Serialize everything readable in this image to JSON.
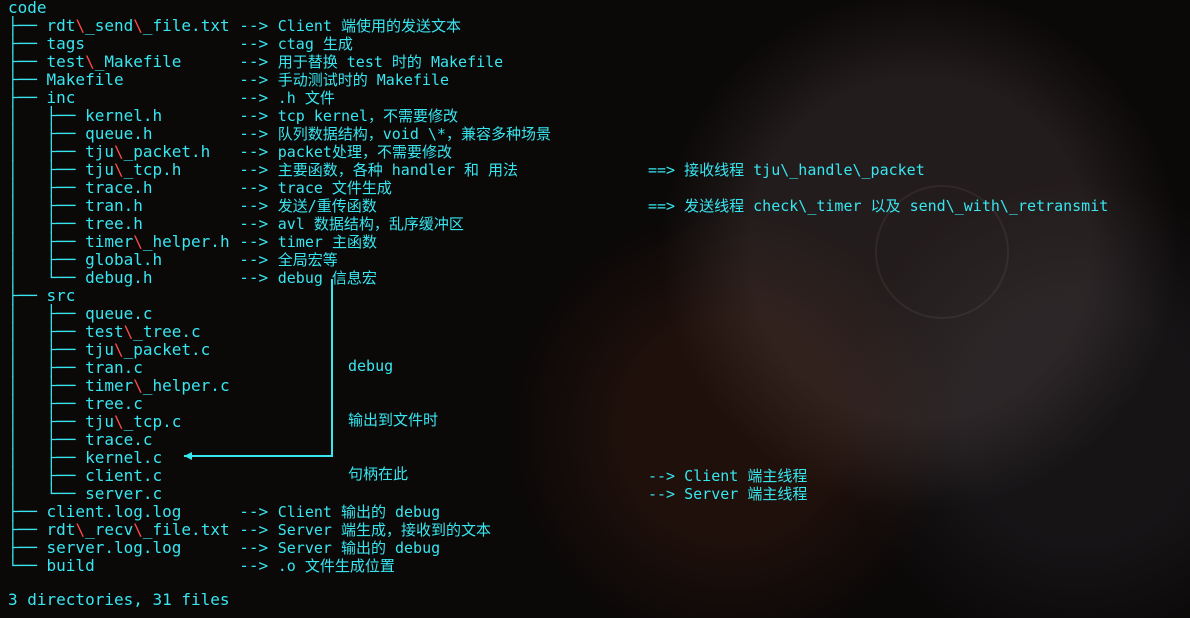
{
  "terminal": {
    "root": "code",
    "summary": "3 directories, 31 files",
    "lines": [
      {
        "prefix": "├── ",
        "parts": [
          [
            "rdt",
            "n"
          ],
          [
            "\\",
            "r"
          ],
          [
            "_send",
            "n"
          ],
          [
            "\\",
            "r"
          ],
          [
            "_file.txt",
            "n"
          ]
        ],
        "arrow": "-->",
        "desc": "Client 端使用的发送文本",
        "desc2": ""
      },
      {
        "prefix": "├── ",
        "parts": [
          [
            "tags",
            "n"
          ]
        ],
        "arrow": "-->",
        "desc": "ctag 生成",
        "desc2": ""
      },
      {
        "prefix": "├── ",
        "parts": [
          [
            "test",
            "n"
          ],
          [
            "\\",
            "r"
          ],
          [
            "_Makefile",
            "n"
          ]
        ],
        "arrow": "-->",
        "desc": "用于替换 test 时的 Makefile",
        "desc2": ""
      },
      {
        "prefix": "├── ",
        "parts": [
          [
            "Makefile",
            "n"
          ]
        ],
        "arrow": "-->",
        "desc": "手动测试时的 Makefile",
        "desc2": ""
      },
      {
        "prefix": "├── ",
        "parts": [
          [
            "inc",
            "n"
          ]
        ],
        "arrow": "-->",
        "desc": ".h 文件",
        "desc2": ""
      },
      {
        "prefix": "│   ├── ",
        "parts": [
          [
            "kernel.h",
            "n"
          ]
        ],
        "arrow": "-->",
        "desc": "tcp kernel，不需要修改",
        "desc2": ""
      },
      {
        "prefix": "│   ├── ",
        "parts": [
          [
            "queue.h",
            "n"
          ]
        ],
        "arrow": "-->",
        "desc": "队列数据结构，void \\*，兼容多种场景",
        "desc2": ""
      },
      {
        "prefix": "│   ├── ",
        "parts": [
          [
            "tju",
            "n"
          ],
          [
            "\\",
            "r"
          ],
          [
            "_packet.h",
            "n"
          ]
        ],
        "arrow": "-->",
        "desc": "packet处理，不需要修改",
        "desc2": ""
      },
      {
        "prefix": "│   ├── ",
        "parts": [
          [
            "tju",
            "n"
          ],
          [
            "\\",
            "r"
          ],
          [
            "_tcp.h",
            "n"
          ]
        ],
        "arrow": "-->",
        "desc": "主要函数，各种 handler 和 用法",
        "desc2": "==> 接收线程 tju\\_handle\\_packet"
      },
      {
        "prefix": "│   ├── ",
        "parts": [
          [
            "trace.h",
            "n"
          ]
        ],
        "arrow": "-->",
        "desc": "trace 文件生成",
        "desc2": ""
      },
      {
        "prefix": "│   ├── ",
        "parts": [
          [
            "tran.h",
            "n"
          ]
        ],
        "arrow": "-->",
        "desc": "发送/重传函数",
        "desc2": "==> 发送线程 check\\_timer 以及 send\\_with\\_retransmit"
      },
      {
        "prefix": "│   ├── ",
        "parts": [
          [
            "tree.h",
            "n"
          ]
        ],
        "arrow": "-->",
        "desc": "avl 数据结构，乱序缓冲区",
        "desc2": ""
      },
      {
        "prefix": "│   ├── ",
        "parts": [
          [
            "timer",
            "n"
          ],
          [
            "\\",
            "r"
          ],
          [
            "_helper.h",
            "n"
          ]
        ],
        "arrow": "-->",
        "desc": "timer 主函数",
        "desc2": ""
      },
      {
        "prefix": "│   ├── ",
        "parts": [
          [
            "global.h",
            "n"
          ]
        ],
        "arrow": "-->",
        "desc": "全局宏等",
        "desc2": ""
      },
      {
        "prefix": "│   └── ",
        "parts": [
          [
            "debug.h",
            "n"
          ]
        ],
        "arrow": "-->",
        "desc": "debug 信息宏",
        "desc2": ""
      },
      {
        "prefix": "├── ",
        "parts": [
          [
            "src",
            "n"
          ]
        ],
        "arrow": "",
        "desc": "",
        "desc2": ""
      },
      {
        "prefix": "│   ├── ",
        "parts": [
          [
            "queue.c",
            "n"
          ]
        ],
        "arrow": "",
        "desc": "",
        "desc2": ""
      },
      {
        "prefix": "│   ├── ",
        "parts": [
          [
            "test",
            "n"
          ],
          [
            "\\",
            "r"
          ],
          [
            "_tree.c",
            "n"
          ]
        ],
        "arrow": "",
        "desc": "",
        "desc2": ""
      },
      {
        "prefix": "│   ├── ",
        "parts": [
          [
            "tju",
            "n"
          ],
          [
            "\\",
            "r"
          ],
          [
            "_packet.c",
            "n"
          ]
        ],
        "arrow": "",
        "desc": "",
        "desc2": ""
      },
      {
        "prefix": "│   ├── ",
        "parts": [
          [
            "tran.c",
            "n"
          ]
        ],
        "arrow": "",
        "desc": "",
        "desc2": ""
      },
      {
        "prefix": "│   ├── ",
        "parts": [
          [
            "timer",
            "n"
          ],
          [
            "\\",
            "r"
          ],
          [
            "_helper.c",
            "n"
          ]
        ],
        "arrow": "",
        "desc": "",
        "desc2": ""
      },
      {
        "prefix": "│   ├── ",
        "parts": [
          [
            "tree.c",
            "n"
          ]
        ],
        "arrow": "",
        "desc": "",
        "desc2": ""
      },
      {
        "prefix": "│   ├── ",
        "parts": [
          [
            "tju",
            "n"
          ],
          [
            "\\",
            "r"
          ],
          [
            "_tcp.c",
            "n"
          ]
        ],
        "arrow": "",
        "desc": "",
        "desc2": ""
      },
      {
        "prefix": "│   ├── ",
        "parts": [
          [
            "trace.c",
            "n"
          ]
        ],
        "arrow": "",
        "desc": "",
        "desc2": ""
      },
      {
        "prefix": "│   ├── ",
        "parts": [
          [
            "kernel.c",
            "n"
          ]
        ],
        "arrow": "",
        "desc": "",
        "desc2": ""
      },
      {
        "prefix": "│   ├── ",
        "parts": [
          [
            "client.c",
            "n"
          ]
        ],
        "arrow": "",
        "desc": "",
        "desc2": "--> Client 端主线程"
      },
      {
        "prefix": "│   └── ",
        "parts": [
          [
            "server.c",
            "n"
          ]
        ],
        "arrow": "",
        "desc": "",
        "desc2": "--> Server 端主线程"
      },
      {
        "prefix": "├── ",
        "parts": [
          [
            "client.log.log",
            "n"
          ]
        ],
        "arrow": "-->",
        "desc": "Client 输出的 debug",
        "desc2": ""
      },
      {
        "prefix": "├── ",
        "parts": [
          [
            "rdt",
            "n"
          ],
          [
            "\\",
            "r"
          ],
          [
            "_recv",
            "n"
          ],
          [
            "\\",
            "r"
          ],
          [
            "_file.txt",
            "n"
          ]
        ],
        "arrow": "-->",
        "desc": "Server 端生成，接收到的文本",
        "desc2": ""
      },
      {
        "prefix": "├── ",
        "parts": [
          [
            "server.log.log",
            "n"
          ]
        ],
        "arrow": "-->",
        "desc": "Server 输出的 debug",
        "desc2": ""
      },
      {
        "prefix": "└── ",
        "parts": [
          [
            "build",
            "n"
          ]
        ],
        "arrow": "-->",
        "desc": ".o 文件生成位置",
        "desc2": ""
      }
    ],
    "callout": {
      "line1": "debug",
      "line2": "输出到文件时",
      "line3": "句柄在此"
    }
  }
}
